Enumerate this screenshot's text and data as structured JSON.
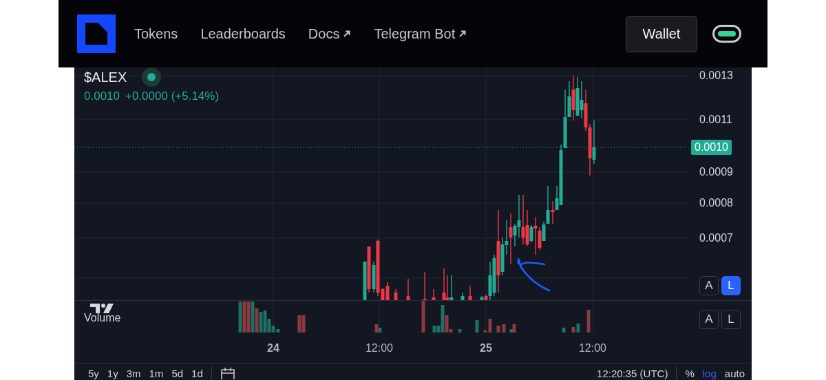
{
  "nav": {
    "links": [
      {
        "label": "Tokens",
        "external": false
      },
      {
        "label": "Leaderboards",
        "external": false
      },
      {
        "label": "Docs",
        "external": true
      },
      {
        "label": "Telegram Bot",
        "external": true
      }
    ],
    "wallet_button": "Wallet",
    "toggle": {
      "on": true
    }
  },
  "chart": {
    "symbol": "$ALEX",
    "live": true,
    "price": "0.0010",
    "change": "+0.0000 (+5.14%)",
    "price_axis": [
      "0.0013",
      "0.0011",
      "0.0009",
      "0.0008",
      "0.0007"
    ],
    "current_price": "0.0010",
    "price_scale_buttons": [
      {
        "label": "A",
        "selected": false
      },
      {
        "label": "L",
        "selected": true
      }
    ],
    "volume_label": "Volume",
    "volume_scale_buttons": [
      {
        "label": "A",
        "selected": false
      },
      {
        "label": "L",
        "selected": false
      }
    ],
    "time_axis": [
      {
        "label": "24",
        "kind": "date"
      },
      {
        "label": "12:00",
        "kind": "time"
      },
      {
        "label": "25",
        "kind": "date"
      },
      {
        "label": "12:00",
        "kind": "time"
      }
    ]
  },
  "bottom_bar": {
    "ranges": [
      "5y",
      "1y",
      "3m",
      "1m",
      "5d",
      "1d"
    ],
    "time": "12:20:35 (UTC)",
    "scale_options": [
      {
        "label": "%",
        "selected": false
      },
      {
        "label": "log",
        "selected": true
      },
      {
        "label": "auto",
        "selected": false
      }
    ]
  }
}
